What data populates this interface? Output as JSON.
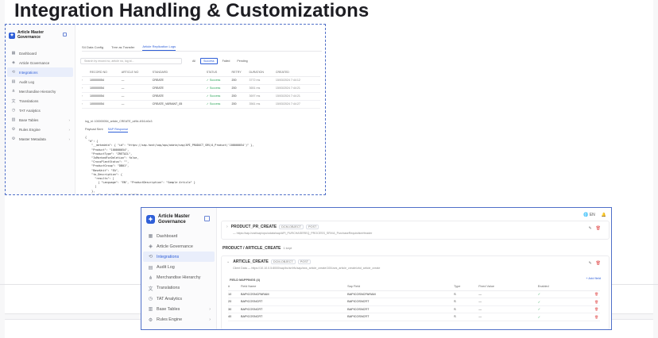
{
  "heading": "Integration Handling & Customizations",
  "colors": {
    "accent": "#2f5fd8",
    "frame": "#4f6fc8",
    "success": "#2ea55b",
    "danger": "#e04848"
  },
  "brand": {
    "line1": "Article Master",
    "line2": "Governance"
  },
  "sidebar": [
    {
      "label": "Dashboard",
      "icon": "grid-icon"
    },
    {
      "label": "Article Governance",
      "icon": "shield-icon"
    },
    {
      "label": "Integrations",
      "icon": "link-icon",
      "active": true
    },
    {
      "label": "Audit Log",
      "icon": "file-icon"
    },
    {
      "label": "Merchandise Hierarchy",
      "icon": "hierarchy-icon"
    },
    {
      "label": "Translations",
      "icon": "translate-icon"
    },
    {
      "label": "TAT Analytics",
      "icon": "clock-icon"
    },
    {
      "label": "Base Tables",
      "icon": "table-icon",
      "chevron": true
    },
    {
      "label": "Rules Engine",
      "icon": "rules-icon",
      "chevron": true
    },
    {
      "label": "Master Metadata",
      "icon": "gear-icon",
      "chevron": true
    }
  ],
  "shot_a": {
    "tabs": [
      {
        "label": "S4 Data Config"
      },
      {
        "label": "Tree as Transfer"
      },
      {
        "label": "Article Replication Logs",
        "active": true
      }
    ],
    "search_placeholder": "Search by record no, article no, log id...",
    "filters": [
      {
        "label": "All"
      },
      {
        "label": "Success",
        "selected": true
      },
      {
        "label": "Failed"
      },
      {
        "label": "Pending"
      }
    ],
    "columns": [
      "RECORD NO",
      "ARTICLE NO",
      "STANDARD",
      "STATUS",
      "RETRY",
      "DURATION",
      "CREATED"
    ],
    "rows": [
      [
        "100000054",
        "—",
        "CREATE",
        "Success",
        "200",
        "3772 ms",
        "15/03/2024 7:44:12"
      ],
      [
        "100000054",
        "—",
        "CREATE",
        "Success",
        "200",
        "3651 ms",
        "15/03/2024 7:44:21"
      ],
      [
        "100000054",
        "—",
        "CREATE",
        "Success",
        "200",
        "3697 ms",
        "15/03/2024 7:44:21"
      ],
      [
        "100000054",
        "—",
        "CREATE_VARIANT_05",
        "Success",
        "200",
        "3561 ms",
        "15/03/2024 7:44:27"
      ]
    ],
    "log_id": "log_id: 100000054_article_CREATE_cd9d-4f16-b0c3",
    "subtabs": [
      {
        "label": "Payload Sent"
      },
      {
        "label": "SAP Response",
        "active": true
      }
    ],
    "code": "{\n  \"d\": {\n    \"__metadata\": { \"id\": \"https://sap.host/sap/opu/odata/sap/API_PRODUCT_SRV/A_Product('100000054')\" },\n    \"Product\": \"100000054\",\n    \"ProductType\": \"ZRETAIL\",\n    \"IsMarkedForDeletion\": false,\n    \"CrossPlantStatus\": \"\",\n    \"ProductGroup\": \"DB01\",\n    \"BaseUnit\": \"EA\",\n    \"to_Description\": {\n      \"results\": [\n        { \"Language\": \"EN\", \"ProductDescription\": \"Sample Article\" }\n      ]\n    },\n    \"to_Plant\": { \"Plant\": \"1000\" }\n  }\n}"
  },
  "shot_b": {
    "language": "EN",
    "block1": {
      "name": "PRODUCT_PR_CREATE",
      "tags": [
        "DCM-OBJECT",
        "POST"
      ],
      "url": "— https://sap-host/sap/opu/odata/sap/API_PURCHASEREQ_PROCESS_SRV/A_PurchaseRequisitionHeader"
    },
    "section": {
      "title": "PRODUCT / ARTICLE_CREATE",
      "count": "1 kept"
    },
    "block2": {
      "name": "ARTICLE_CREATE",
      "tags": [
        "DCM-OBJECT",
        "POST"
      ],
      "url": "Client Data — https://10.10.0.5:8000/sap/bc/srt/rfc/sap/zws_article_create/100/zws_article_create/zbd_article_create",
      "field_mappings_label": "FIELD MAPPINGS (4)",
      "add_field": "+ Add field",
      "columns": [
        "#",
        "Field Name",
        "Sap Field",
        "Type",
        "Fixed Value",
        "Enabled",
        ""
      ],
      "rows": [
        [
          "10",
          "BAPICOSNCPARAM",
          "BAPICOSNCPARAM",
          "S",
          "—",
          "✓"
        ],
        [
          "20",
          "BAPICOSNCRT",
          "BAPICOSNCRT",
          "S",
          "—",
          "✓"
        ],
        [
          "30",
          "BAPICOSNCRT",
          "BAPICOSNCRT",
          "S",
          "—",
          "✓"
        ],
        [
          "40",
          "BAPICOSNCRT",
          "BAPICOSNCRT",
          "S",
          "—",
          "✓"
        ]
      ]
    }
  }
}
